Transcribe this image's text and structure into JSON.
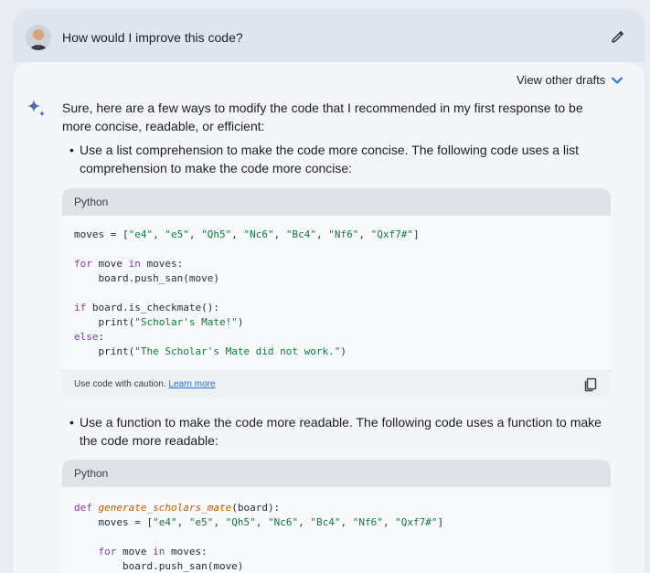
{
  "prompt": {
    "text": "How would I improve this code?"
  },
  "drafts": {
    "label": "View other drafts"
  },
  "answer": {
    "intro": "Sure, here are a few ways to modify the code that I recommended in my first response to be more concise, readable, or efficient:"
  },
  "bullets": [
    {
      "bullet": "•",
      "text": "Use a list comprehension to make the code more concise. The following code uses a list comprehension to make the code more concise:"
    },
    {
      "bullet": "•",
      "text": "Use a function to make the code more readable. The following code uses a function to make the code more readable:"
    }
  ],
  "code_blocks": [
    {
      "language": "Python",
      "lines": [
        "moves = [\"e4\", \"e5\", \"Qh5\", \"Nc6\", \"Bc4\", \"Nf6\", \"Qxf7#\"]",
        "",
        "for move in moves:",
        "    board.push_san(move)",
        "",
        "if board.is_checkmate():",
        "    print(\"Scholar's Mate!\")",
        "else:",
        "    print(\"The Scholar's Mate did not work.\")"
      ],
      "caution": "Use code with caution.",
      "learn_more": "Learn more"
    },
    {
      "language": "Python",
      "lines": [
        "def generate_scholars_mate(board):",
        "    moves = [\"e4\", \"e5\", \"Qh5\", \"Nc6\", \"Bc4\", \"Nf6\", \"Qxf7#\"]",
        "",
        "    for move in moves:",
        "        board.push_san(move)"
      ]
    }
  ],
  "icons": {
    "avatar": "avatar",
    "edit": "pencil-icon",
    "drafts_toggle": "chevron-down-icon",
    "assistant": "sparkle-icon",
    "copy": "copy-icon"
  },
  "colors": {
    "accent": "#1a73e8",
    "keyword": "#7b3fa2",
    "string": "#0f7a3c",
    "function": "#c45a00"
  }
}
